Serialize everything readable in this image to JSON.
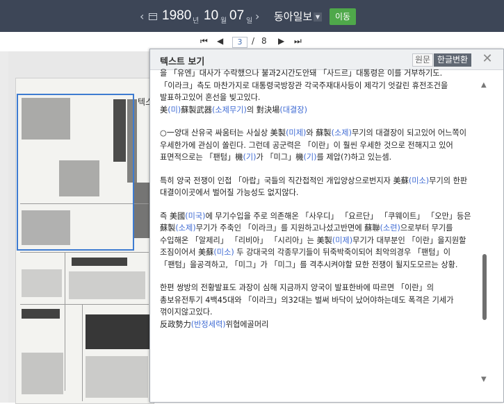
{
  "topbar": {
    "prev_arrow": "‹",
    "next_arrow": "›",
    "year": "1980",
    "year_unit": "년",
    "month": "10",
    "month_unit": "월",
    "day": "07",
    "day_unit": "일",
    "newspaper": "동아일보",
    "go_label": "이동"
  },
  "pager": {
    "first": "⏮",
    "prev": "◀",
    "current_page": "3",
    "separator": "/",
    "total_pages": "8",
    "next": "▶",
    "last": "⏭"
  },
  "behind_text": "텍스",
  "behind_text2": "스크",
  "text_panel": {
    "title": "텍스트 보기",
    "tab_original": "원문",
    "tab_hangul": "한글변환",
    "close": "✕",
    "paragraphs": [
      {
        "segments": [
          {
            "t": "을 「유엔」대사가 수락했으나 불과2시간도안돼 「사드르」대통령은 이를 거부하기도. 「이라크」측도 마찬가지로 대통령국방장관 각국주재대사등이 제각기 엇갈린 휴전조건을 발표하고있어 혼선을 빚고있다.\n美",
            "b": false
          },
          {
            "t": "(미)",
            "b": true
          },
          {
            "t": "蘇製武器",
            "b": false
          },
          {
            "t": "(소제무기)",
            "b": true
          },
          {
            "t": "의 對決場",
            "b": false
          },
          {
            "t": "(대결장)",
            "b": true
          }
        ]
      },
      {
        "segments": [
          {
            "t": " ○一양대 산유국 싸움터는 사실상 美製",
            "b": false
          },
          {
            "t": "(미제)",
            "b": true
          },
          {
            "t": "와 蘇製",
            "b": false
          },
          {
            "t": "(소제)",
            "b": true
          },
          {
            "t": "무기의 대결장이 되고있어 어느쪽이 우세한가에 관심이 쏠린다. 그런데 공군력은 「이란」이 훨씬 우세한 것으로 전해지고 있어 표면적으로는 「팬텀」機",
            "b": false
          },
          {
            "t": "(기)",
            "b": true
          },
          {
            "t": "가 「미그」機",
            "b": false
          },
          {
            "t": "(기)",
            "b": true
          },
          {
            "t": "를 제압(?)하고 있는셈.",
            "b": false
          }
        ]
      },
      {
        "segments": [
          {
            "t": " 특히 양국 전쟁이 인접 「아랍」국들의 직간접적인 개입양상으로번지자 美蘇",
            "b": false
          },
          {
            "t": "(미소)",
            "b": true
          },
          {
            "t": "무기의 한판 대결이이곳에서 벌어질 가능성도 없지않다.",
            "b": false
          }
        ]
      },
      {
        "segments": [
          {
            "t": " 즉 美國",
            "b": false
          },
          {
            "t": "(미국)",
            "b": true
          },
          {
            "t": "에 무기수입을 주로 의존해온 「사우디」 「요르단」 「쿠웨이트」 「오만」등은 蘇製",
            "b": false
          },
          {
            "t": "(소제)",
            "b": true
          },
          {
            "t": "무기가 주축인 「이라크」를 지원하고나섰고반면에 蘇聯",
            "b": false
          },
          {
            "t": "(소련)",
            "b": true
          },
          {
            "t": "으로부터 무기를 수입해온 「알제리」 「리비아」 「시리아」는 美製",
            "b": false
          },
          {
            "t": "(미제)",
            "b": true
          },
          {
            "t": "무기가 대부분인 「이란」을지원할 조짐이어서 美蘇",
            "b": false
          },
          {
            "t": "(미소)",
            "b": true
          },
          {
            "t": " 두 강대국의 각종무기들이 뒤죽박죽이되어 최악의경우 「팬텀」이 「팬텀」을공격하고, 「미그」가 「미그」를 격추시켜야할 묘한 전쟁이 될지도모르는 상황.",
            "b": false
          }
        ]
      },
      {
        "segments": [
          {
            "t": " 한편 쌍방의 전황발표도 과장이 심해 지금까지 양국이 발표한바에 따르면 「이란」의 총보유전투기 4백45대와 「이라크」의32대는 벌써 바닥이 났어야하는데도 폭격은 기세가 꺾이지않고있다.\n反政勢力",
            "b": false
          },
          {
            "t": "(반정세력)",
            "b": true
          },
          {
            "t": "위협에골머리",
            "b": false
          }
        ]
      }
    ]
  },
  "colors": {
    "topbar_bg": "#3d4657",
    "go_button": "#4fa84a",
    "link_blue": "#3e6ad3",
    "highlight_border": "#3d7bd1"
  }
}
